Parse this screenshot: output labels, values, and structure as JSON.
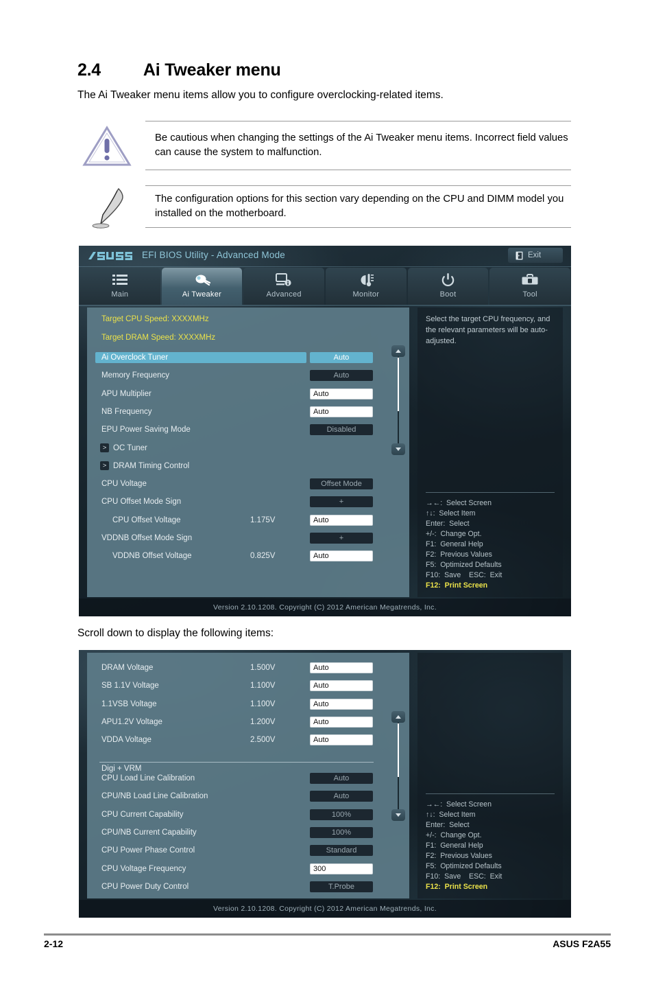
{
  "document": {
    "section_number": "2.4",
    "section_title": "Ai Tweaker menu",
    "intro": "The Ai Tweaker menu items allow you to configure overclocking-related items.",
    "warning": "Be cautious when changing the settings of the Ai Tweaker menu items. Incorrect field values can cause the system to malfunction.",
    "note": "The configuration options for this section vary depending on the CPU and DIMM model you installed on the motherboard.",
    "scroll_note": "Scroll down to display the following items:",
    "page_number": "2-12",
    "product": "ASUS F2A55"
  },
  "bios": {
    "title": "EFI BIOS Utility - Advanced Mode",
    "exit_label": "Exit",
    "logo_text": "ASUS",
    "version_footer": "Version 2.10.1208.   Copyright (C) 2012 American Megatrends, Inc.",
    "tabs": [
      {
        "label": "Main",
        "icon": "list-icon",
        "active": false
      },
      {
        "label": "Ai Tweaker",
        "icon": "tweaker-icon",
        "active": true
      },
      {
        "label": "Advanced",
        "icon": "advanced-icon",
        "active": false
      },
      {
        "label": "Monitor",
        "icon": "monitor-icon",
        "active": false
      },
      {
        "label": "Boot",
        "icon": "power-icon",
        "active": false
      },
      {
        "label": "Tool",
        "icon": "toolbox-icon",
        "active": false
      }
    ],
    "help_top": "Select the target CPU frequency, and the relevant parameters will be auto-adjusted.",
    "nav_keys": [
      {
        "text": "→←:  Select Screen",
        "highlight": false
      },
      {
        "text": "↑↓:  Select Item",
        "highlight": false
      },
      {
        "text": "Enter:  Select",
        "highlight": false
      },
      {
        "text": "+/-:  Change Opt.",
        "highlight": false
      },
      {
        "text": "F1:  General Help",
        "highlight": false
      },
      {
        "text": "F2:  Previous Values",
        "highlight": false
      },
      {
        "text": "F5:  Optimized Defaults",
        "highlight": false
      },
      {
        "text": "F10:  Save    ESC:  Exit",
        "highlight": false
      },
      {
        "text": "F12:  Print Screen",
        "highlight": true
      }
    ],
    "panel_top": {
      "target_cpu": "Target CPU Speed: XXXXMHz",
      "target_dram": "Target DRAM Speed: XXXXMHz",
      "items": [
        {
          "label": "Ai Overclock Tuner",
          "mid": "",
          "value": "Auto",
          "style": "sel",
          "selected": true,
          "kind": "option"
        },
        {
          "label": "Memory Frequency",
          "mid": "",
          "value": "Auto",
          "style": "dark",
          "selected": false,
          "kind": "option"
        },
        {
          "label": "APU Multiplier",
          "mid": "",
          "value": "Auto",
          "style": "white",
          "selected": false,
          "kind": "input"
        },
        {
          "label": "NB Frequency",
          "mid": "",
          "value": "Auto",
          "style": "white",
          "selected": false,
          "kind": "input"
        },
        {
          "label": "EPU Power Saving Mode",
          "mid": "",
          "value": "Disabled",
          "style": "dark",
          "selected": false,
          "kind": "option"
        },
        {
          "label": "OC Tuner",
          "mid": "",
          "value": "",
          "style": "none",
          "selected": false,
          "kind": "submenu"
        },
        {
          "label": "DRAM Timing Control",
          "mid": "",
          "value": "",
          "style": "none",
          "selected": false,
          "kind": "submenu"
        },
        {
          "label": "CPU Voltage",
          "mid": "",
          "value": "Offset Mode",
          "style": "dark",
          "selected": false,
          "kind": "option"
        },
        {
          "label": "CPU Offset Mode Sign",
          "mid": "",
          "value": "+",
          "style": "dark",
          "selected": false,
          "kind": "option"
        },
        {
          "label": "CPU Offset Voltage",
          "mid": "1.175V",
          "value": "Auto",
          "style": "white",
          "selected": false,
          "kind": "input-sub"
        },
        {
          "label": "VDDNB Offset Mode Sign",
          "mid": "",
          "value": "+",
          "style": "dark",
          "selected": false,
          "kind": "option"
        },
        {
          "label": "VDDNB Offset Voltage",
          "mid": "0.825V",
          "value": "Auto",
          "style": "white",
          "selected": false,
          "kind": "input-sub"
        }
      ]
    },
    "panel_bottom": {
      "group_title": "Digi + VRM",
      "items_a": [
        {
          "label": "DRAM Voltage",
          "mid": "1.500V",
          "value": "Auto",
          "style": "white",
          "kind": "input"
        },
        {
          "label": "SB 1.1V Voltage",
          "mid": "1.100V",
          "value": "Auto",
          "style": "white",
          "kind": "input"
        },
        {
          "label": "1.1VSB Voltage",
          "mid": "1.100V",
          "value": "Auto",
          "style": "white",
          "kind": "input"
        },
        {
          "label": "APU1.2V Voltage",
          "mid": "1.200V",
          "value": "Auto",
          "style": "white",
          "kind": "input"
        },
        {
          "label": "VDDA Voltage",
          "mid": "2.500V",
          "value": "Auto",
          "style": "white",
          "kind": "input"
        }
      ],
      "items_b": [
        {
          "label": "CPU Load Line Calibration",
          "mid": "",
          "value": "Auto",
          "style": "dark",
          "kind": "option"
        },
        {
          "label": "CPU/NB Load Line Calibration",
          "mid": "",
          "value": "Auto",
          "style": "dark",
          "kind": "option"
        },
        {
          "label": "CPU Current Capability",
          "mid": "",
          "value": "100%",
          "style": "dark",
          "kind": "option"
        },
        {
          "label": "CPU/NB Current Capability",
          "mid": "",
          "value": "100%",
          "style": "dark",
          "kind": "option"
        },
        {
          "label": "CPU Power Phase Control",
          "mid": "",
          "value": "Standard",
          "style": "dark",
          "kind": "option"
        },
        {
          "label": "CPU Voltage Frequency",
          "mid": "",
          "value": "300",
          "style": "white",
          "kind": "input"
        },
        {
          "label": "CPU Power Duty Control",
          "mid": "",
          "value": "T.Probe",
          "style": "dark",
          "kind": "option"
        }
      ]
    }
  },
  "colors": {
    "accent_cyan": "#63b3ce",
    "yellow": "#ebe24a",
    "panel_bg": "#5d7c89",
    "dark_field": "#1c2730",
    "title_cyan": "#8fc6d8"
  }
}
